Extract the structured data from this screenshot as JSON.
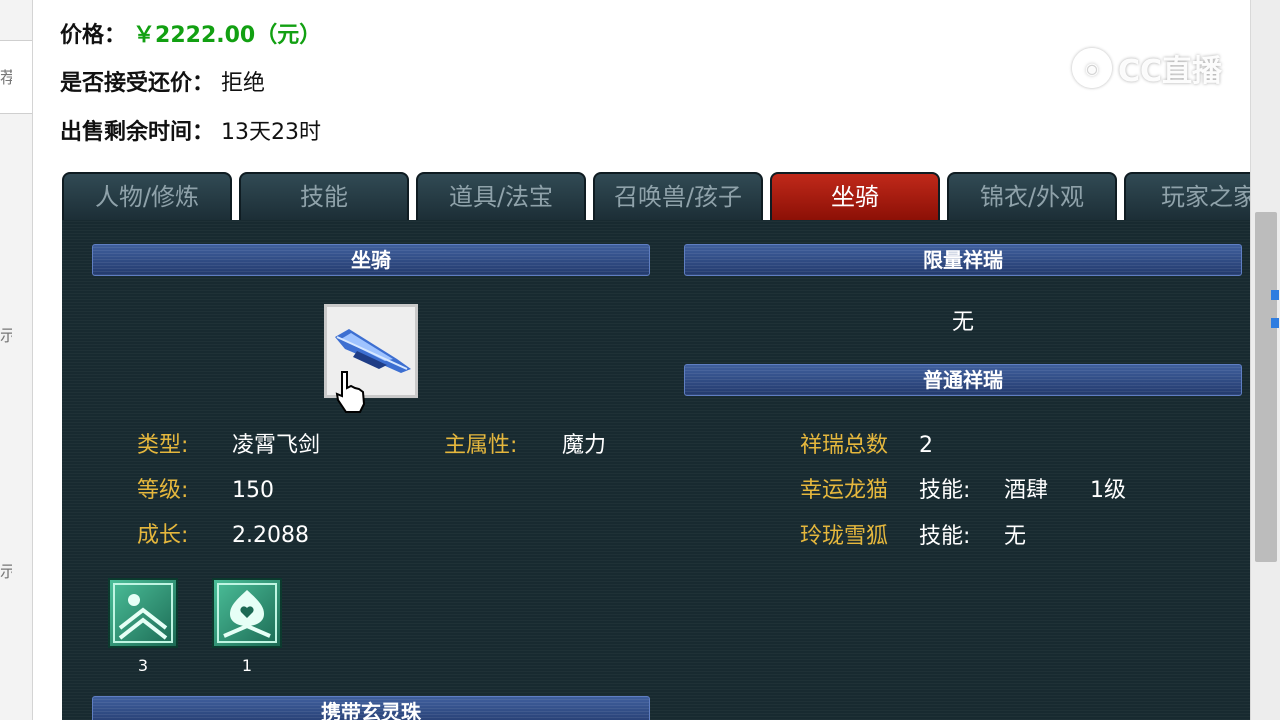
{
  "info": {
    "price_label": "价格：",
    "price_value": "￥2222.00（元）",
    "bargain_label": "是否接受还价：",
    "bargain_value": "拒绝",
    "remaining_label": "出售剩余时间：",
    "remaining_value": "13天23时"
  },
  "watermark": {
    "text": "CC直播",
    "icon": "cc-logo-icon"
  },
  "left_fragments": [
    "荐",
    "示",
    "示"
  ],
  "tabs": [
    {
      "label": "人物/修炼",
      "active": false
    },
    {
      "label": "技能",
      "active": false
    },
    {
      "label": "道具/法宝",
      "active": false
    },
    {
      "label": "召唤兽/孩子",
      "active": false
    },
    {
      "label": "坐骑",
      "active": true
    },
    {
      "label": "锦衣/外观",
      "active": false
    },
    {
      "label": "玩家之家",
      "active": false
    }
  ],
  "mount": {
    "header": "坐骑",
    "image_icon": "flying-sword-mount-icon",
    "cursor_icon": "hand-pointer-icon",
    "type_label": "类型:",
    "type_value": "凌霄飞剑",
    "main_attr_label": "主属性:",
    "main_attr_value": "魔力",
    "level_label": "等级:",
    "level_value": "150",
    "growth_label": "成长:",
    "growth_value": "2.2088",
    "skills": [
      {
        "icon": "mount-skill-icon",
        "count": "3"
      },
      {
        "icon": "mount-skill-heart-icon",
        "count": "1"
      }
    ],
    "bottom_header": "携带玄灵珠"
  },
  "limited_xiangrui": {
    "header": "限量祥瑞",
    "value": "无"
  },
  "normal_xiangrui": {
    "header": "普通祥瑞",
    "total_label": "祥瑞总数",
    "total_value": "2",
    "items": [
      {
        "name": "幸运龙猫",
        "skill_label": "技能:",
        "skill_value": "酒肆",
        "level": "1级"
      },
      {
        "name": "玲珑雪狐",
        "skill_label": "技能:",
        "skill_value": "无",
        "level": ""
      }
    ]
  },
  "colors": {
    "price": "#12a012",
    "tab_active": "#c0291a",
    "panel_bg": "#182a30",
    "label_gold": "#e5b73d",
    "header_bar": "#2c467f"
  }
}
